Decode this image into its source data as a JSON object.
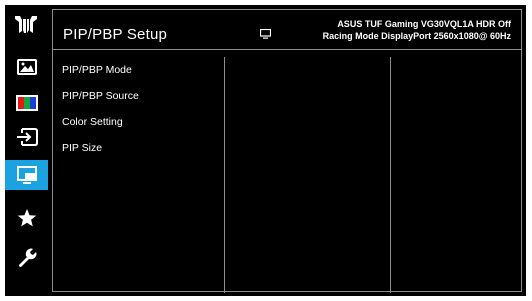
{
  "header": {
    "title": "PIP/PBP Setup",
    "info_line1": "ASUS TUF Gaming  VG30VQL1A HDR Off",
    "info_line2": "Racing Mode  DisplayPort  2560x1080@ 60Hz",
    "info_icon": "monitor-icon"
  },
  "sidebar": {
    "logo": "tuf-gaming-logo",
    "active_color": "#1aa3e0",
    "items": [
      {
        "icon": "image-icon"
      },
      {
        "icon": "color-bars-icon"
      },
      {
        "icon": "input-select-icon"
      },
      {
        "icon": "pip-pbp-icon",
        "active": true
      },
      {
        "icon": "star-icon"
      },
      {
        "icon": "wrench-icon"
      }
    ]
  },
  "menu": {
    "items": [
      {
        "label": "PIP/PBP Mode"
      },
      {
        "label": "PIP/PBP Source"
      },
      {
        "label": "Color Setting"
      },
      {
        "label": "PIP Size"
      }
    ]
  }
}
